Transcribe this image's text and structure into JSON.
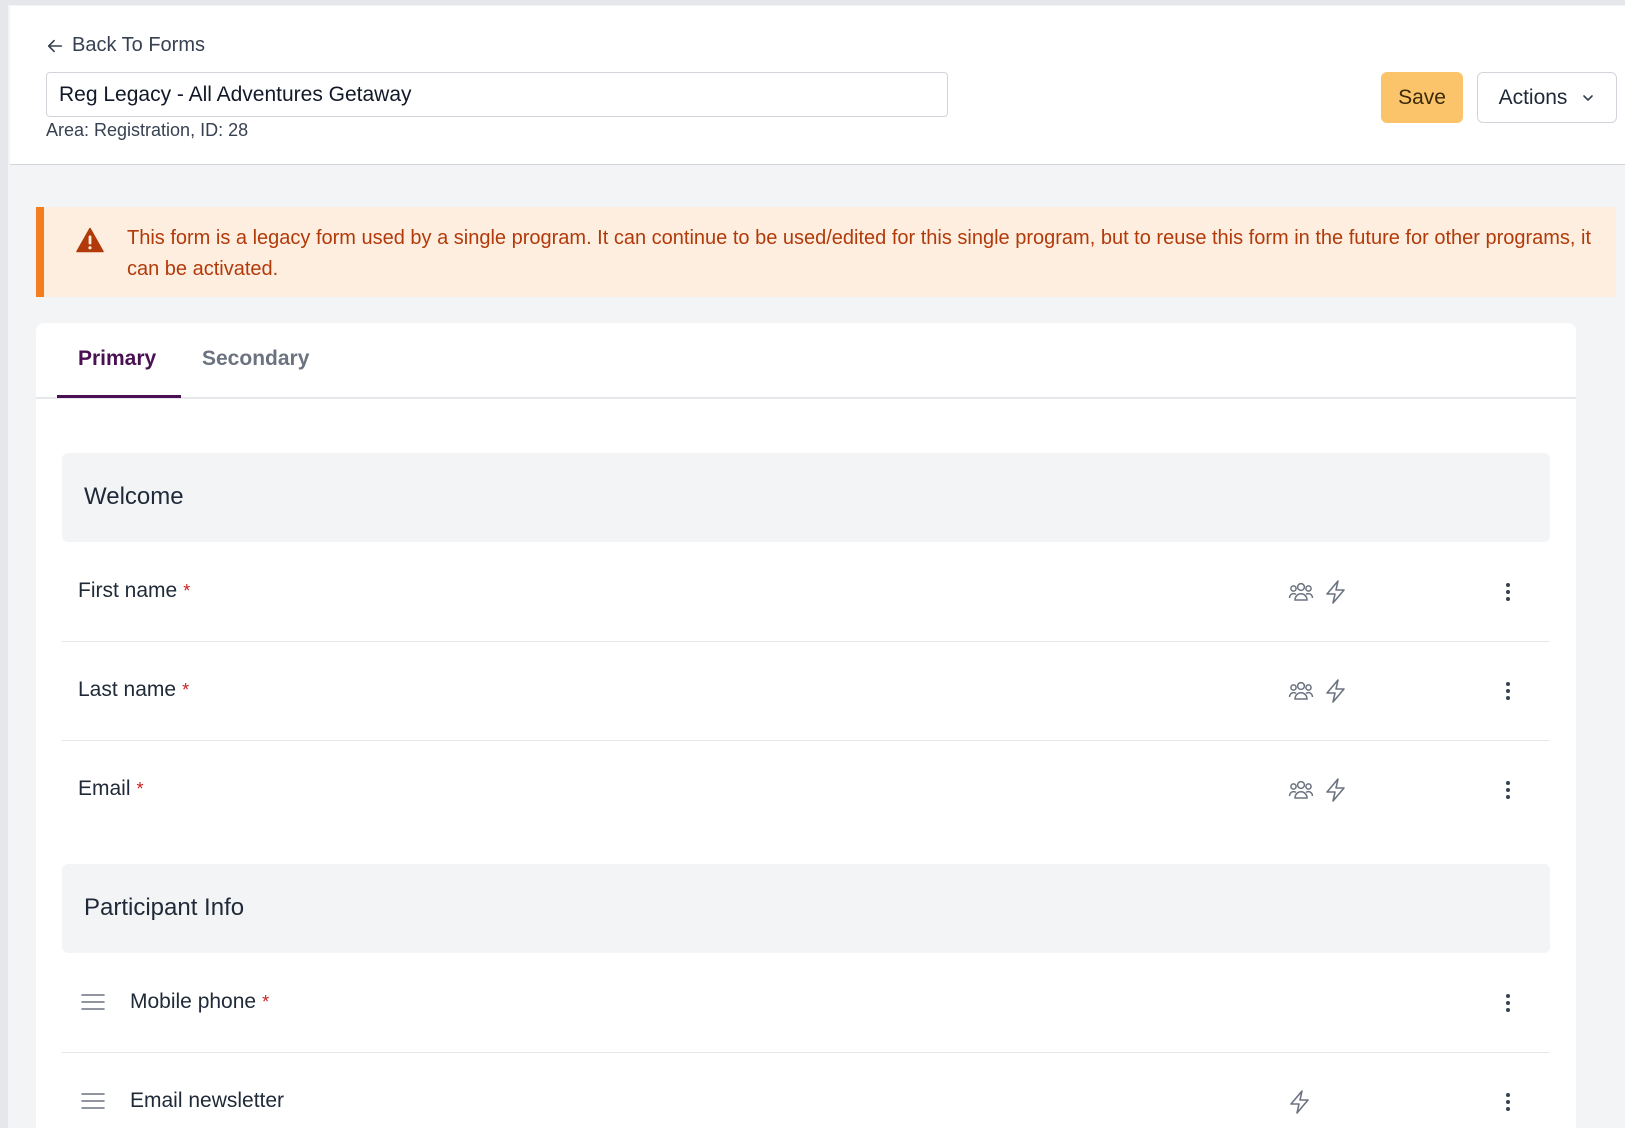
{
  "header": {
    "back_label": "Back To Forms",
    "form_title": "Reg Legacy - All Adventures Getaway",
    "meta": "Area: Registration, ID: 28",
    "save_label": "Save",
    "actions_label": "Actions"
  },
  "alert": {
    "message": "This form is a legacy form used by a single program. It can continue to be used/edited for this single program, but to reuse this form in the future for other programs, it can be activated."
  },
  "tabs": [
    {
      "label": "Primary",
      "active": true
    },
    {
      "label": "Secondary",
      "active": false
    }
  ],
  "sections": [
    {
      "title": "Welcome",
      "fields": [
        {
          "label": "First name",
          "required": "*"
        },
        {
          "label": "Last name",
          "required": "*"
        },
        {
          "label": "Email",
          "required": "*"
        }
      ]
    },
    {
      "title": "Participant Info",
      "fields": [
        {
          "label": "Mobile phone",
          "required": "*"
        },
        {
          "label": "Email newsletter",
          "required": ""
        }
      ]
    }
  ],
  "colors": {
    "brand": "#4a1152",
    "save": "#fbc46a",
    "alert_bg": "#fdeedf",
    "alert_border": "#f57c1f",
    "alert_text": "#b23a0a",
    "required": "#c81e1e"
  }
}
